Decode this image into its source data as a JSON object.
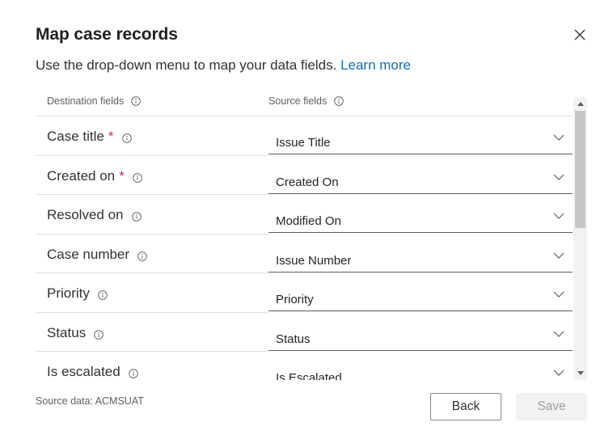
{
  "dialog": {
    "title": "Map case records",
    "subtitle": "Use the drop-down menu to map your data fields.",
    "learn_more": "Learn more"
  },
  "columns": {
    "destination": "Destination fields",
    "source": "Source fields"
  },
  "rows": [
    {
      "dest": "Case title",
      "required": "*",
      "source": "Issue Title"
    },
    {
      "dest": "Created on",
      "required": "*",
      "source": "Created On"
    },
    {
      "dest": "Resolved on",
      "required": "",
      "source": "Modified On"
    },
    {
      "dest": "Case number",
      "required": "",
      "source": "Issue Number"
    },
    {
      "dest": "Priority",
      "required": "",
      "source": "Priority"
    },
    {
      "dest": "Status",
      "required": "",
      "source": "Status"
    },
    {
      "dest": "Is escalated",
      "required": "",
      "source": "Is Escalated"
    }
  ],
  "footer": {
    "source_data": "Source data: ACMSUAT",
    "back_label": "Back",
    "save_label": "Save"
  },
  "icons": {
    "close": "close-icon",
    "info": "info-icon",
    "chevron": "chevron-down-icon"
  },
  "colors": {
    "link": "#0f6cbd",
    "required": "#c4314b"
  }
}
